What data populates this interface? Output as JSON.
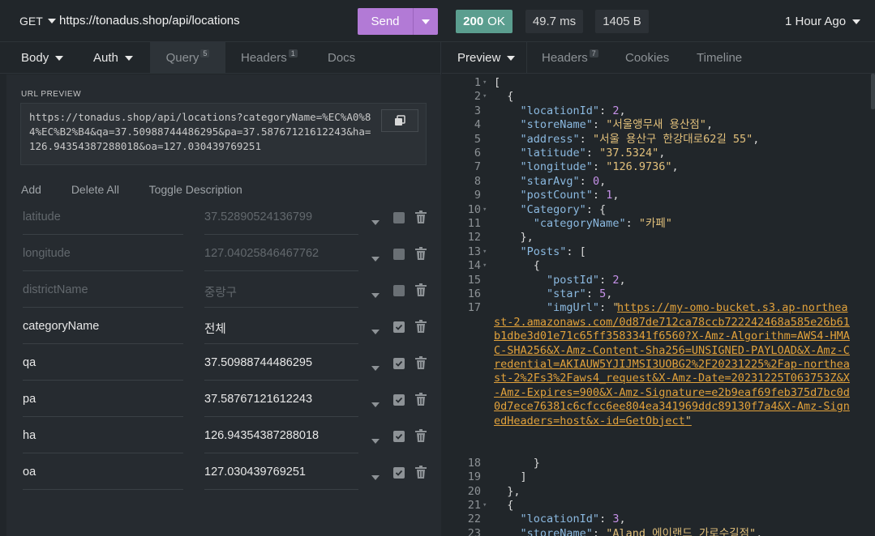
{
  "request": {
    "method": "GET",
    "url": "https://tonadus.shop/api/locations",
    "send_label": "Send"
  },
  "response_meta": {
    "status_code": "200",
    "status_text": "OK",
    "time": "49.7 ms",
    "size": "1405 B",
    "ago": "1 Hour Ago"
  },
  "left_tabs": {
    "body": "Body",
    "auth": "Auth",
    "query": "Query",
    "query_count": "5",
    "headers": "Headers",
    "headers_count": "1",
    "docs": "Docs"
  },
  "url_preview": {
    "label": "URL PREVIEW",
    "value": "https://tonadus.shop/api/locations?categoryName=%EC%A0%84%EC%B2%B4&qa=37.50988744486295&pa=37.58767121612243&ha=126.94354387288018&oa=127.030439769251"
  },
  "param_actions": {
    "add": "Add",
    "delete_all": "Delete All",
    "toggle_description": "Toggle Description"
  },
  "params": [
    {
      "name": "latitude",
      "value": "37.52890524136799",
      "enabled": false
    },
    {
      "name": "longitude",
      "value": "127.04025846467762",
      "enabled": false
    },
    {
      "name": "districtName",
      "value": "중랑구",
      "enabled": false
    },
    {
      "name": "categoryName",
      "value": "전체",
      "enabled": true
    },
    {
      "name": "qa",
      "value": "37.50988744486295",
      "enabled": true
    },
    {
      "name": "pa",
      "value": "37.58767121612243",
      "enabled": true
    },
    {
      "name": "ha",
      "value": "126.94354387288018",
      "enabled": true
    },
    {
      "name": "oa",
      "value": "127.030439769251",
      "enabled": true
    }
  ],
  "right_tabs": {
    "preview": "Preview",
    "headers": "Headers",
    "headers_count": "7",
    "cookies": "Cookies",
    "timeline": "Timeline"
  },
  "code": {
    "l1": "[",
    "l2": "  {",
    "l3k": "\"locationId\"",
    "l3v": "2",
    "l4k": "\"storeName\"",
    "l4v": "\"서울앵무새 용산점\"",
    "l5k": "\"address\"",
    "l5v": "\"서울 용산구 한강대로62길 55\"",
    "l6k": "\"latitude\"",
    "l6v": "\"37.5324\"",
    "l7k": "\"longitude\"",
    "l7v": "\"126.9736\"",
    "l8k": "\"starAvg\"",
    "l8v": "0",
    "l9k": "\"postCount\"",
    "l9v": "1",
    "l10k": "\"Category\"",
    "l11k": "\"categoryName\"",
    "l11v": "\"카페\"",
    "l12": "    },",
    "l13k": "\"Posts\"",
    "l14": "      {",
    "l15k": "\"postId\"",
    "l15v": "2",
    "l16k": "\"star\"",
    "l16v": "5",
    "l17k": "\"imgUrl\"",
    "l17v": "https://my-omo-bucket.s3.ap-northeast-2.amazonaws.com/0d87de712ca78ccb722242468a585e26b61b1dbe3d01e71c65ff3583341f6560?X-Amz-Algorithm=AWS4-HMAC-SHA256&X-Amz-Content-Sha256=UNSIGNED-PAYLOAD&X-Amz-Credential=AKIAUW5YJIJMSI3UOBG2%2F20231225%2Fap-northeast-2%2Fs3%2Faws4_request&X-Amz-Date=20231225T063753Z&X-Amz-Expires=900&X-Amz-Signature=e2b9eaf69feb375d7bc0d0d7ece76381c6cfcc6ee804ea341969ddc89130f7a4&X-Amz-SignedHeaders=host&x-id=GetObject",
    "l18": "      }",
    "l19": "    ]",
    "l20": "  },",
    "l21": "  {",
    "l22k": "\"locationId\"",
    "l22v": "3",
    "l23k": "\"storeName\"",
    "l23v": "\"Aland 에이랜드 가로수길점\""
  }
}
